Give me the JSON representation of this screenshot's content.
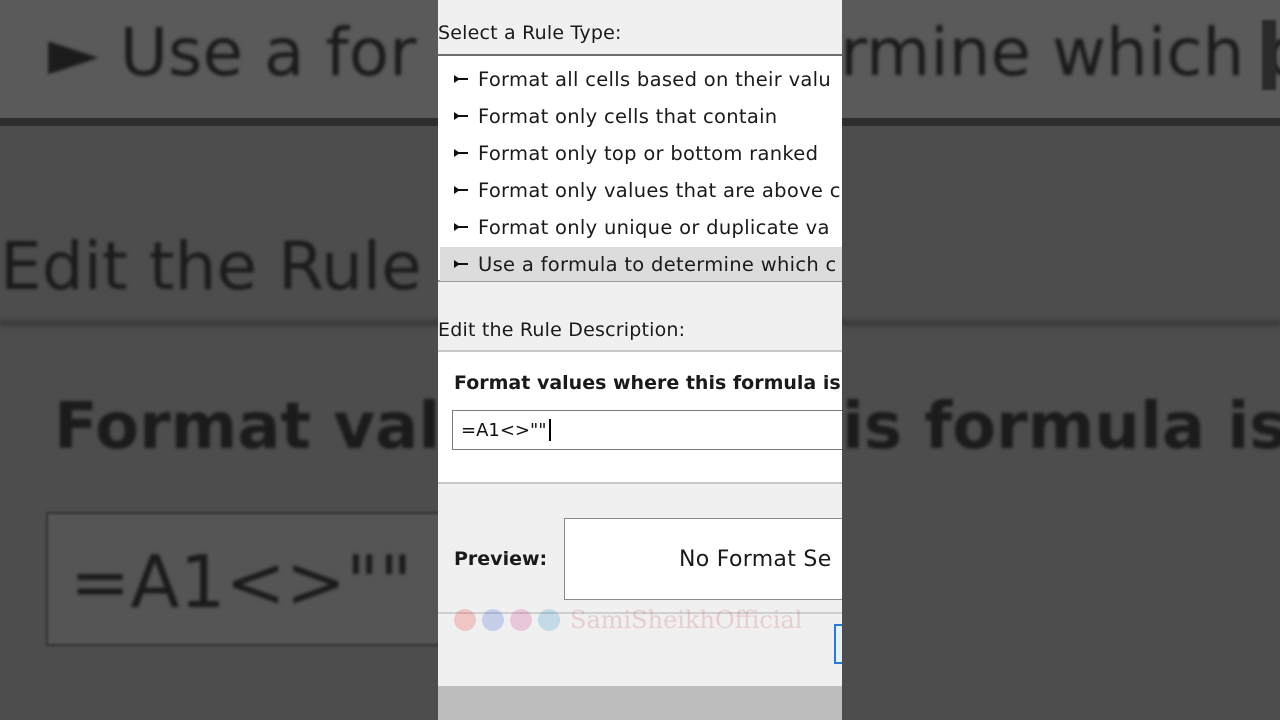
{
  "dialog": {
    "select_rule_type_label": "Select a Rule Type:",
    "rule_types": [
      {
        "label": "Format all cells based on their valu",
        "selected": false
      },
      {
        "label": "Format only cells that contain",
        "selected": false
      },
      {
        "label": "Format only top or bottom ranked",
        "selected": false
      },
      {
        "label": "Format only values that are above c",
        "selected": false
      },
      {
        "label": "Format only unique or duplicate va",
        "selected": false
      },
      {
        "label": "Use a formula to determine which c",
        "selected": true
      }
    ],
    "edit_rule_description_label": "Edit the Rule Description:",
    "formula_label": "Format values where this formula is t",
    "formula_value": "=A1<>\"\"",
    "preview_label": "Preview:",
    "preview_text": "No Format Se",
    "watermark": "SamiSheikhOfficial"
  },
  "background": {
    "line1_left": "Use a for",
    "line1_right": "rmine which c",
    "line2": "Edit the Rule",
    "line3_left": "Format valu",
    "line3_right": "is formula is t",
    "input_text": "=A1<>\"\""
  },
  "colors": {
    "selection_bg": "#dcdcdc",
    "dialog_bg": "#f0f0f0",
    "backdrop": "#4d4d4d",
    "focus_blue": "#2a7ad8"
  }
}
